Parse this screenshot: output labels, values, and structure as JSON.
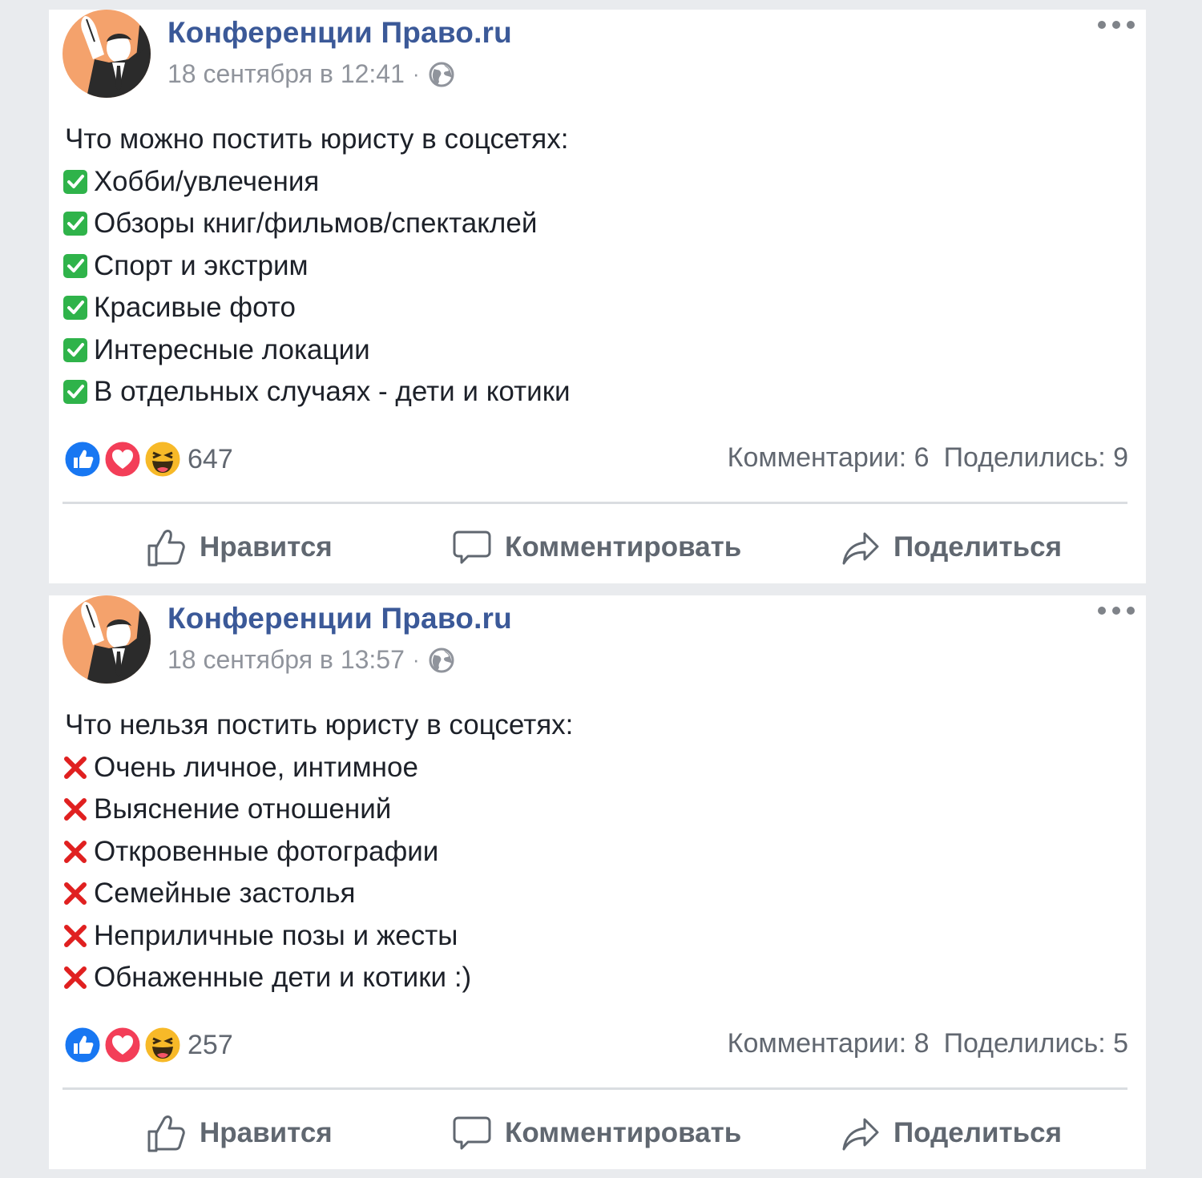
{
  "posts": [
    {
      "author": "Конференции Право.ru",
      "timestamp": "18 сентября в 12:41",
      "separator": "·",
      "privacy_icon": "globe-icon",
      "intro": "Что можно постить юристу в соцсетях:",
      "bullet_icon": "green-check-icon",
      "items": [
        "Хобби/увлечения",
        "Обзоры книг/фильмов/спектаклей",
        "Спорт и экстрим",
        "Красивые фото",
        "Интересные локации",
        "В отдельных случаях - дети и котики"
      ],
      "reaction_count": "647",
      "comments": "Комментарии: 6",
      "shares": "Поделились: 9",
      "actions": {
        "like": "Нравится",
        "comment": "Комментировать",
        "share": "Поделиться"
      }
    },
    {
      "author": "Конференции Право.ru",
      "timestamp": "18 сентября в 13:57",
      "separator": "·",
      "privacy_icon": "globe-icon",
      "intro": "Что нельзя постить юристу в соцсетях:",
      "bullet_icon": "red-cross-icon",
      "items": [
        "Очень личное, интимное",
        "Выяснение отношений",
        "Откровенные фотографии",
        "Семейные застолья",
        "Неприличные позы и жесты",
        "Обнаженные дети и котики :)"
      ],
      "reaction_count": "257",
      "comments": "Комментарии: 8",
      "shares": "Поделились: 5",
      "actions": {
        "like": "Нравится",
        "comment": "Комментировать",
        "share": "Поделиться"
      }
    }
  ],
  "colors": {
    "page_background": "#e9ebee",
    "author_link": "#3b5998",
    "secondary_text": "#90949c",
    "check_green": "#2fb34a",
    "cross_red": "#e02020",
    "like_blue": "#1877f2",
    "love_red": "#f33e58",
    "haha_yellow": "#f7b928",
    "avatar_orange": "#f4a26c"
  }
}
